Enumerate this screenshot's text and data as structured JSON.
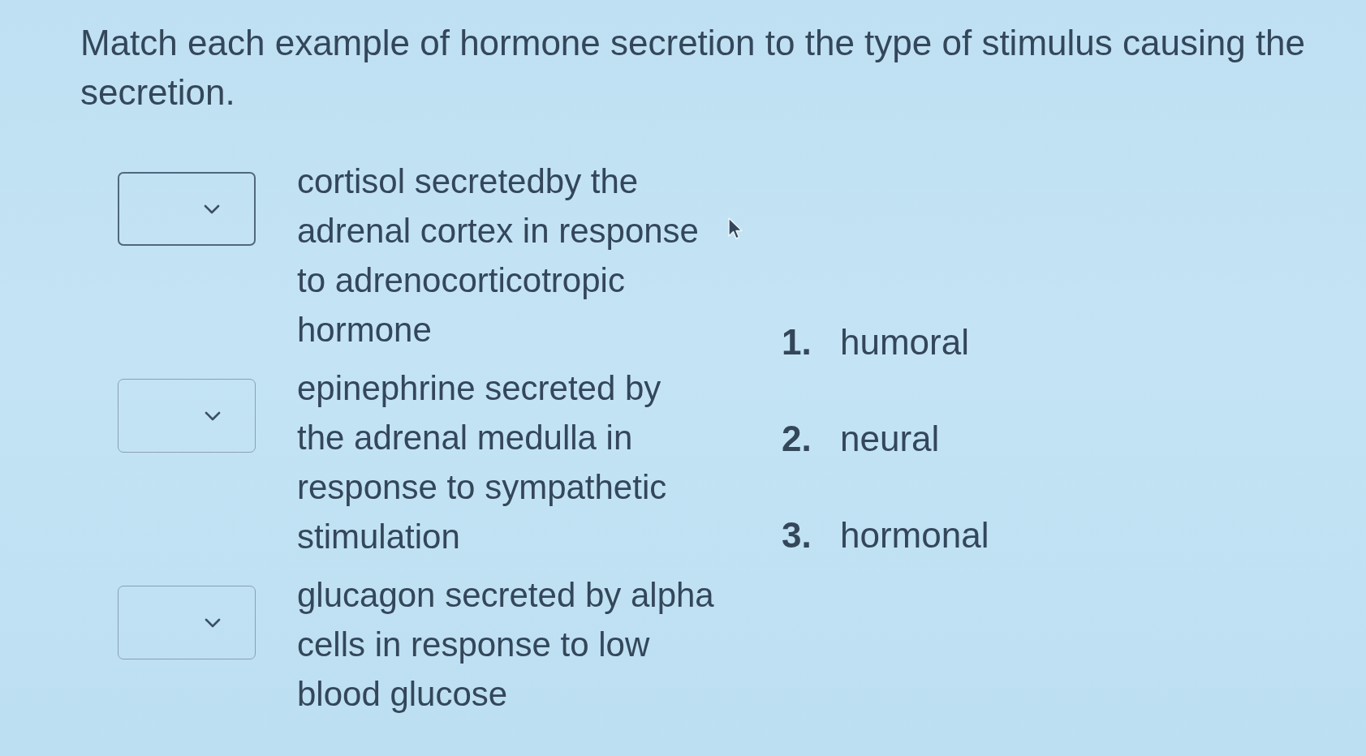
{
  "instruction": "Match each example of hormone secretion to the type of stimulus causing the secretion.",
  "matches": [
    {
      "focused": true,
      "text": "cortisol secretedby the adrenal cortex in response to adrenocorticotropic hormone"
    },
    {
      "focused": false,
      "text": "epinephrine secreted by the adrenal medulla in response to sympathetic stimulation"
    },
    {
      "focused": false,
      "text": "glucagon secreted by alpha cells in response to low blood glucose"
    }
  ],
  "options": [
    {
      "number": "1.",
      "label": "humoral"
    },
    {
      "number": "2.",
      "label": "neural"
    },
    {
      "number": "3.",
      "label": "hormonal"
    }
  ]
}
